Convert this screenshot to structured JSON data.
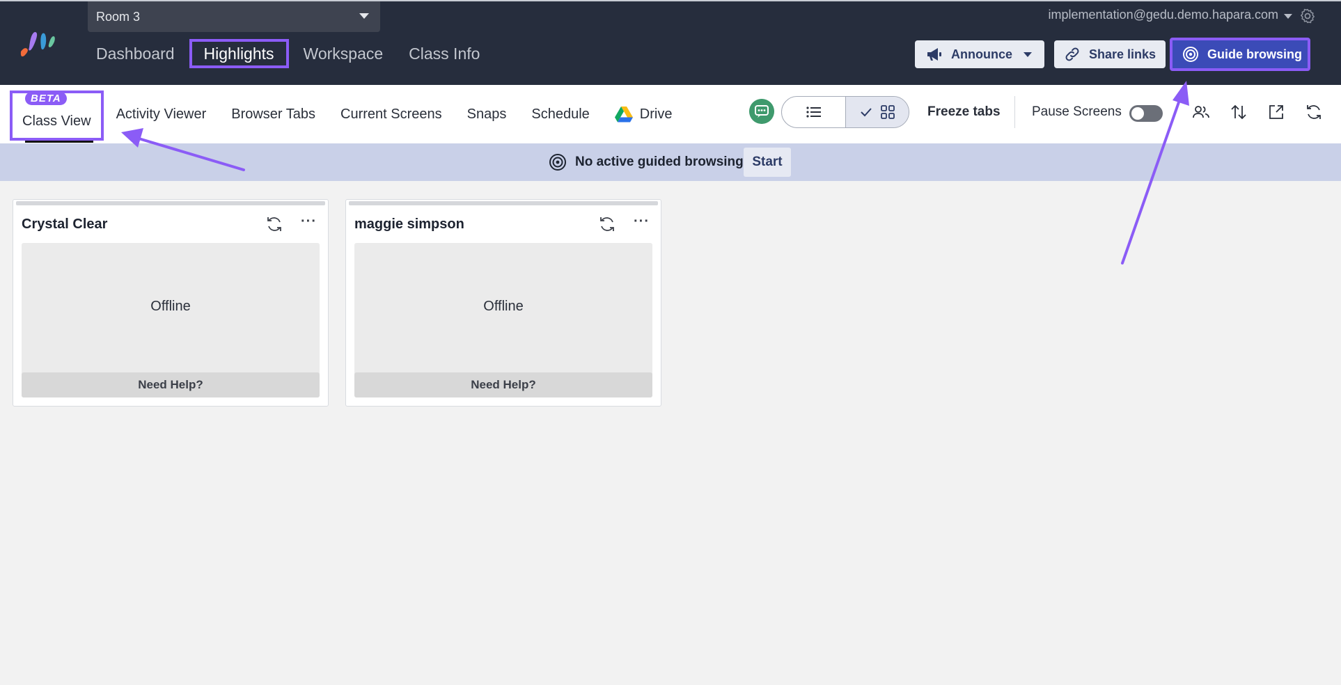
{
  "header": {
    "class_selector": "Room 3",
    "user_email": "implementation@gedu.demo.hapara.com",
    "nav": [
      {
        "label": "Dashboard"
      },
      {
        "label": "Highlights"
      },
      {
        "label": "Workspace"
      },
      {
        "label": "Class Info"
      }
    ],
    "active_nav": "Highlights",
    "buttons": {
      "announce": "Announce",
      "share_links": "Share links",
      "guide_browsing": "Guide browsing"
    }
  },
  "subnav": {
    "beta_badge": "BETA",
    "tabs": [
      {
        "label": "Class View"
      },
      {
        "label": "Activity Viewer"
      },
      {
        "label": "Browser Tabs"
      },
      {
        "label": "Current Screens"
      },
      {
        "label": "Snaps"
      },
      {
        "label": "Schedule"
      },
      {
        "label": "Drive"
      }
    ],
    "active_tab": "Class View",
    "freeze_tabs": "Freeze tabs",
    "pause_screens": "Pause Screens",
    "pause_screens_on": false,
    "view_mode": "grid",
    "icons": [
      "students-icon",
      "sort-icon",
      "open-external-icon",
      "refresh-icon"
    ]
  },
  "banner": {
    "text": "No active guided browsing",
    "start_label": "Start"
  },
  "students": [
    {
      "name": "Crystal Clear",
      "status": "Offline",
      "help_label": "Need Help?"
    },
    {
      "name": "maggie simpson",
      "status": "Offline",
      "help_label": "Need Help?"
    }
  ],
  "colors": {
    "header_bg": "#262d3d",
    "highlight": "#8b5cf6",
    "guide_button": "#3b4bb7",
    "banner_bg": "#c9d0e8"
  }
}
